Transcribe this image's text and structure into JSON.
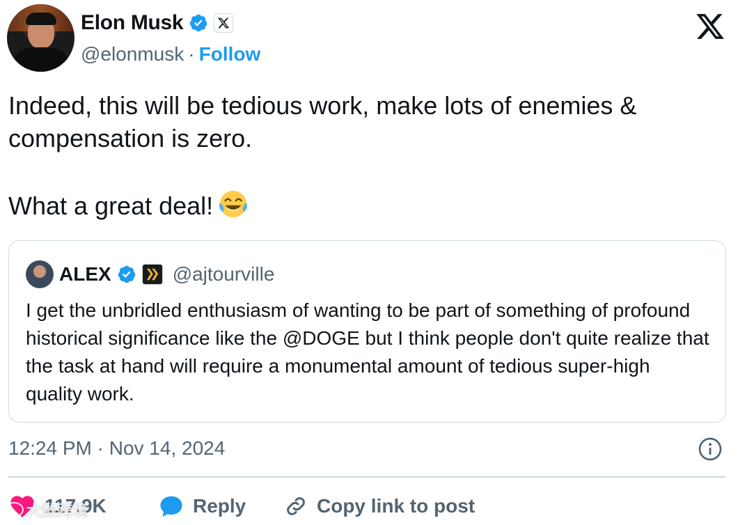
{
  "author": {
    "name": "Elon Musk",
    "handle": "@elonmusk",
    "separator": "·",
    "follow_label": "Follow"
  },
  "tweet": {
    "line1": "Indeed, this will be tedious work, make lots of enemies &",
    "line2": "compensation is zero.",
    "line3": "What a great deal!",
    "emoji": "face-with-tears-of-joy"
  },
  "quote": {
    "name": "ALEX",
    "handle": "@ajtourville",
    "text": "I get the unbridled enthusiasm of wanting to be part of something of profound historical significance like the @DOGE but I think people don't quite realize that the task at hand will require a monumental amount of tedious super-high quality work."
  },
  "meta": {
    "timestamp": "12:24 PM · Nov 14, 2024"
  },
  "actions": {
    "likes": "117.9K",
    "reply_label": "Reply",
    "copy_label": "Copy link to post"
  },
  "watermark": {
    "text": "大数跨境"
  },
  "colors": {
    "accent": "#1d9bf0",
    "like": "#f91880",
    "secondary_text": "#536471",
    "border": "#cfd9de"
  }
}
